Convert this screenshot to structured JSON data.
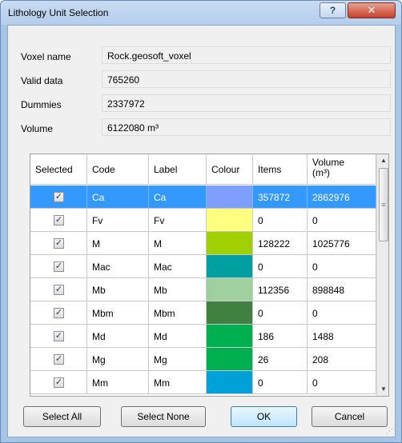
{
  "window": {
    "title": "Lithology Unit Selection",
    "help_glyph": "?",
    "close_glyph": "✕"
  },
  "info": [
    {
      "label": "Voxel name",
      "value": "Rock.geosoft_voxel"
    },
    {
      "label": "Valid data",
      "value": "765260"
    },
    {
      "label": "Dummies",
      "value": "2337972"
    },
    {
      "label": "Volume",
      "value": "6122080 m³"
    }
  ],
  "grid": {
    "headers": {
      "selected": "Selected",
      "code": "Code",
      "label": "Label",
      "colour": "Colour",
      "items": "Items",
      "volume_line1": "Volume",
      "volume_line2": "(m³)"
    },
    "check_glyph": "✓",
    "rows": [
      {
        "selected": true,
        "code": "Ca",
        "label": "Ca",
        "colour": "#7f9fff",
        "items": "357872",
        "volume": "2862976"
      },
      {
        "selected": true,
        "code": "Fv",
        "label": "Fv",
        "colour": "#ffff80",
        "items": "0",
        "volume": "0"
      },
      {
        "selected": true,
        "code": "M",
        "label": "M",
        "colour": "#a0d000",
        "items": "128222",
        "volume": "1025776"
      },
      {
        "selected": true,
        "code": "Mac",
        "label": "Mac",
        "colour": "#00a0a0",
        "items": "0",
        "volume": "0"
      },
      {
        "selected": true,
        "code": "Mb",
        "label": "Mb",
        "colour": "#a0d0a0",
        "items": "112356",
        "volume": "898848"
      },
      {
        "selected": true,
        "code": "Mbm",
        "label": "Mbm",
        "colour": "#408040",
        "items": "0",
        "volume": "0"
      },
      {
        "selected": true,
        "code": "Md",
        "label": "Md",
        "colour": "#00b050",
        "items": "186",
        "volume": "1488"
      },
      {
        "selected": true,
        "code": "Mg",
        "label": "Mg",
        "colour": "#00b050",
        "items": "26",
        "volume": "208"
      },
      {
        "selected": true,
        "code": "Mm",
        "label": "Mm",
        "colour": "#00a0d8",
        "items": "0",
        "volume": "0"
      }
    ],
    "selected_row": 0
  },
  "buttons": {
    "select_all": "Select All",
    "select_none": "Select None",
    "ok": "OK",
    "cancel": "Cancel"
  }
}
